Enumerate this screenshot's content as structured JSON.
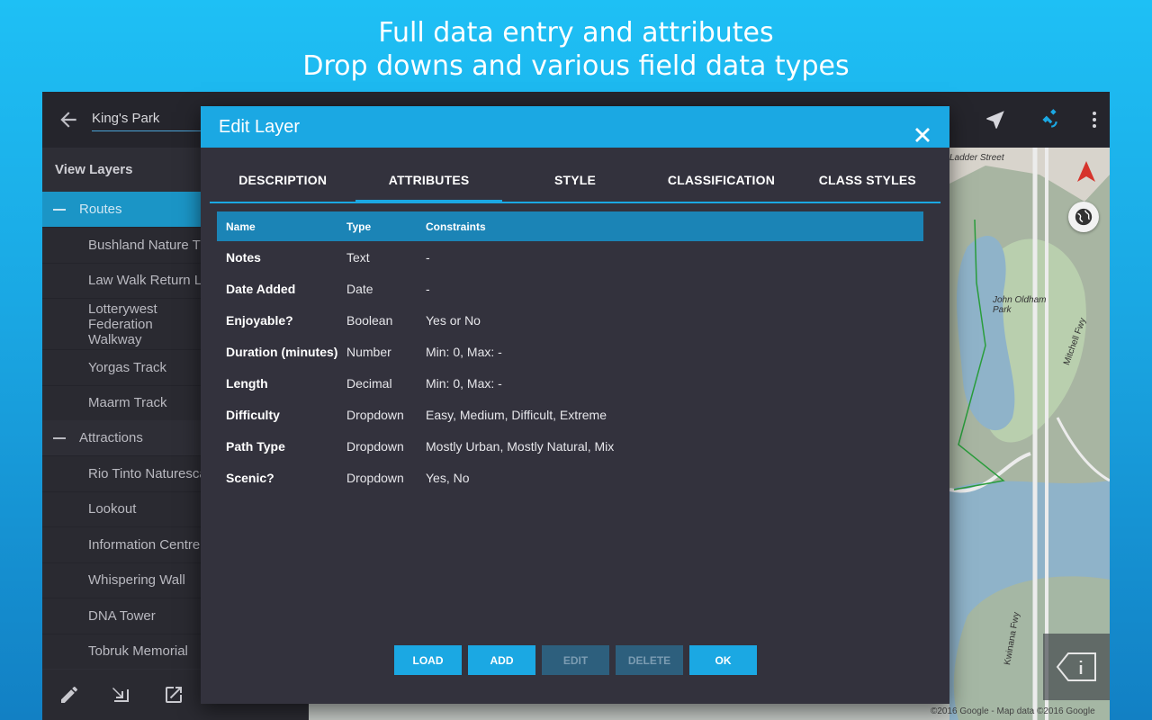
{
  "promo": {
    "line1": "Full data entry and attributes",
    "line2": "Drop downs and various field data types"
  },
  "appbar": {
    "search_value": "King's Park",
    "icons": [
      "back-arrow-icon",
      "navigation-arrow-icon",
      "satellite-icon",
      "more-vert-icon"
    ]
  },
  "sidebar": {
    "header": "View Layers",
    "groups": [
      {
        "label": "Routes",
        "items": [
          "Bushland Nature Trail",
          "Law Walk Return Loop",
          "Lotterywest Federation Walkway",
          "Yorgas Track",
          "Maarm Track"
        ]
      },
      {
        "label": "Attractions",
        "items": [
          "Rio Tinto Naturescape",
          "Lookout",
          "Information Centre",
          "Whispering Wall",
          "DNA Tower",
          "Tobruk Memorial"
        ]
      }
    ],
    "bottom_icons": [
      "pencil-icon",
      "import-icon",
      "share-icon"
    ]
  },
  "map": {
    "labels": [
      "Ladder Street",
      "John Oldham Park",
      "Mitchell Fwy",
      "Kwinana Fwy"
    ],
    "copyright": "©2016 Google - Map data ©2016 Google"
  },
  "dialog": {
    "title": "Edit Layer",
    "tabs": [
      "DESCRIPTION",
      "ATTRIBUTES",
      "STYLE",
      "CLASSIFICATION",
      "CLASS STYLES"
    ],
    "active_tab": "ATTRIBUTES",
    "table": {
      "headers": {
        "name": "Name",
        "type": "Type",
        "constraints": "Constraints"
      },
      "rows": [
        {
          "name": "Notes",
          "type": "Text",
          "constraints": "-"
        },
        {
          "name": "Date Added",
          "type": "Date",
          "constraints": "-"
        },
        {
          "name": "Enjoyable?",
          "type": "Boolean",
          "constraints": "Yes or No"
        },
        {
          "name": "Duration (minutes)",
          "type": "Number",
          "constraints": "Min: 0, Max: -"
        },
        {
          "name": "Length",
          "type": "Decimal",
          "constraints": "Min: 0, Max: -"
        },
        {
          "name": "Difficulty",
          "type": "Dropdown",
          "constraints": "Easy,  Medium,  Difficult,  Extreme"
        },
        {
          "name": "Path Type",
          "type": "Dropdown",
          "constraints": "Mostly Urban,  Mostly Natural,  Mix"
        },
        {
          "name": "Scenic?",
          "type": "Dropdown",
          "constraints": "Yes,  No"
        }
      ]
    },
    "buttons": {
      "load": "LOAD",
      "add": "ADD",
      "edit": "EDIT",
      "delete": "DELETE",
      "ok": "OK"
    }
  },
  "colors": {
    "accent": "#1ba8e3",
    "dialog_bg": "#33323d",
    "table_header": "#1b84b6",
    "disabled_button": "#2d5f7d"
  }
}
